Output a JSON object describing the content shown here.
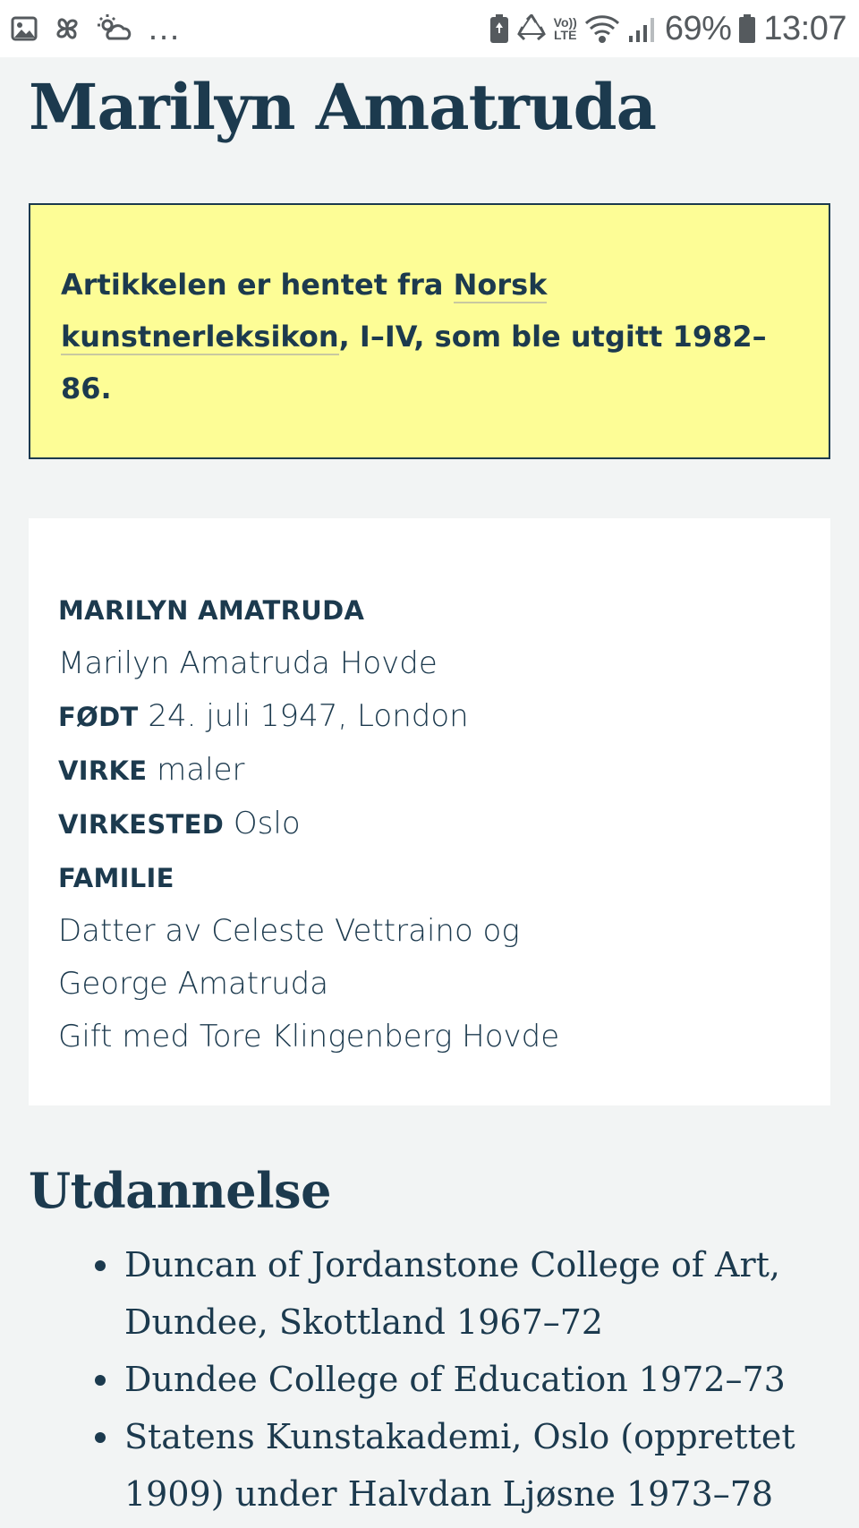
{
  "status_bar": {
    "battery_percent": "69%",
    "time": "13:07",
    "volte_top": "Vo))",
    "volte_bottom": "LTE",
    "overflow": "…",
    "icons": [
      "image-icon",
      "pinwheel-icon",
      "sun-cloud-icon",
      "battery-saver-icon",
      "recycle-icon",
      "volte-icon",
      "wifi-icon",
      "signal-icon",
      "battery-icon"
    ]
  },
  "article": {
    "title": "Marilyn Amatruda",
    "notice": {
      "text_before": "Artikkelen er hentet fra ",
      "link": "Norsk kunstnerleksikon",
      "text_after": ", I–IV, som ble utgitt 1982–86."
    },
    "facts": {
      "name_heading": "MARILYN AMATRUDA",
      "full_name": "Marilyn Amatruda Hovde",
      "born_label": "FØDT",
      "born_value": " 24. juli 1947, London",
      "occupation_label": "VIRKE",
      "occupation_value": " maler",
      "place_label": "VIRKESTED",
      "place_value": " Oslo",
      "family_label": "FAMILIE",
      "family_line1": "Datter av Celeste Vettraino og",
      "family_line2": "George Amatruda",
      "family_line3": "Gift med Tore Klingenberg Hovde"
    },
    "education": {
      "title": "Utdannelse",
      "items": [
        "Duncan of Jordanstone College of Art, Dundee, Skottland 1967–72",
        "Dundee College of Education 1972–73",
        "Statens Kunstakademi, Oslo (opprettet 1909) under Halvdan Ljøsne 1973–78"
      ]
    }
  }
}
